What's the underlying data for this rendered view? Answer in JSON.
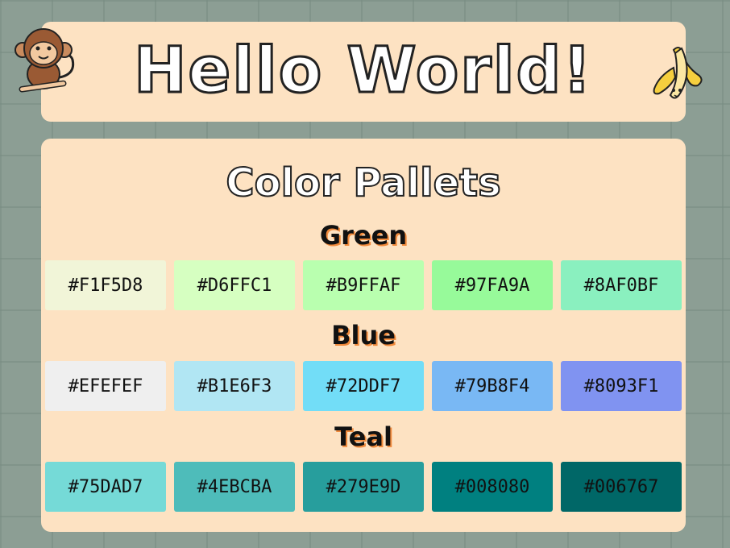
{
  "header": {
    "title": "Hello World!"
  },
  "panel": {
    "title": "Color Pallets",
    "sections": [
      {
        "label": "Green",
        "swatches": [
          "#F1F5D8",
          "#D6FFC1",
          "#B9FFAF",
          "#97FA9A",
          "#8AF0BF"
        ]
      },
      {
        "label": "Blue",
        "swatches": [
          "#EFEFEF",
          "#B1E6F3",
          "#72DDF7",
          "#79B8F4",
          "#8093F1"
        ]
      },
      {
        "label": "Teal",
        "swatches": [
          "#75DAD7",
          "#4EBCBA",
          "#279E9D",
          "#008080",
          "#006767"
        ]
      }
    ]
  },
  "icons": {
    "left": "monkey-icon",
    "right": "banana-icon"
  }
}
